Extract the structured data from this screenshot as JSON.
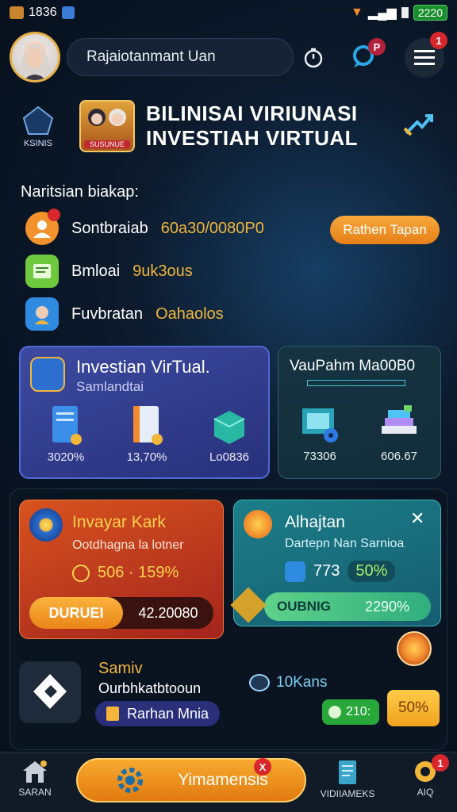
{
  "status_bar": {
    "time": "1836",
    "battery": "2220"
  },
  "header": {
    "search_placeholder": "Rajaiotanmant Uan",
    "chat_badge": "P",
    "menu_badge": "1"
  },
  "title_area": {
    "home_label": "KSINIS",
    "logo_text": "SUSUNUE",
    "title_line1": "BILINISAI VIRIUNASI",
    "title_line2": "INVESTIAH VIRTUAL"
  },
  "info": {
    "heading": "Naritsian biakap:",
    "items": [
      {
        "label": "Sontbraiab",
        "value": "60a30/0080P0",
        "icon": "user-icon"
      },
      {
        "label": "Bmloai",
        "value": "9uk3ous",
        "icon": "document-icon"
      },
      {
        "label": "Fuvbratan",
        "value": "Oahaolos",
        "icon": "person-icon"
      }
    ],
    "action_label": "Rathen Tapan"
  },
  "investment_card": {
    "title": "Investian VirTual.",
    "subtitle": "Samlandtai",
    "items": [
      {
        "value": "3020%",
        "icon": "file-icon"
      },
      {
        "value": "13,70%",
        "icon": "book-icon"
      },
      {
        "value": "Lo0836",
        "icon": "box-icon"
      }
    ]
  },
  "side_card": {
    "title": "VauPahm Ma00B0",
    "items": [
      {
        "value": "73306",
        "icon": "chart-gear-icon"
      },
      {
        "value": "606.67",
        "icon": "stack-icon"
      }
    ]
  },
  "red_card": {
    "title": "Invayar Kark",
    "subtitle": "Ootdhagna la lotner",
    "stat": "506 · 159%",
    "button_label": "DURUEI",
    "amount": "42.20080"
  },
  "cyan_card": {
    "title": "Alhajtan",
    "subtitle": "Dartepn Nan Sarnioa",
    "stat_value": "773",
    "stat_percent": "50%",
    "button_label": "OUBNIG",
    "button_value": "2290%"
  },
  "bottom_card": {
    "title": "Samiv",
    "subtitle": "Ourbhkatbtooun",
    "tag_label": "Rarhan Mnia",
    "users_label": "10Kans",
    "green_value": "210:",
    "yellow_value": "50%"
  },
  "nav": {
    "items": [
      "SARAN",
      "",
      "VIDIIAMEKS",
      "AIQ"
    ],
    "center_label": "Yimamensis",
    "center_badge": "X",
    "ai_badge": "1"
  },
  "colors": {
    "accent": "#f2b63a",
    "primary_orange": "#e68018",
    "bg": "#07101d"
  }
}
